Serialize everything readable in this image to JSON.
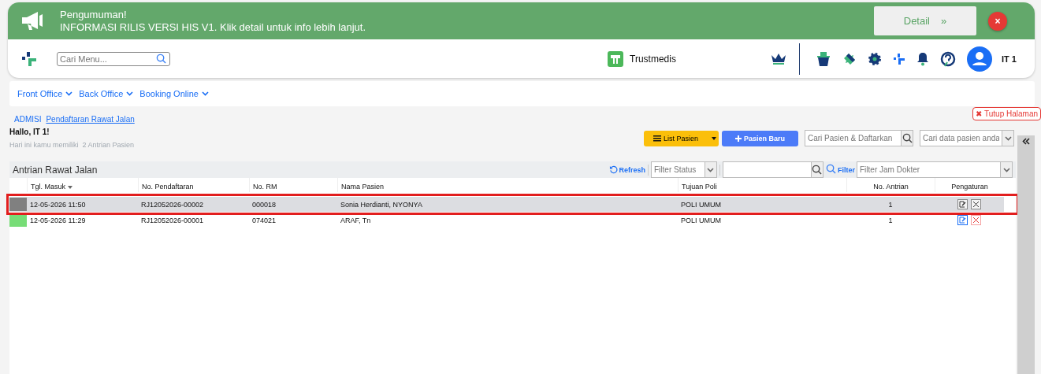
{
  "announcement": {
    "title": "Pengumuman!",
    "message": "INFORMASI RILIS VERSI HIS V1. Klik detail untuk info lebih lanjut.",
    "detail_button": "Detail",
    "detail_arrow": "»",
    "close": "×"
  },
  "header": {
    "search": {
      "placeholder": "Cari Menu..."
    },
    "brand": "Trustmedis",
    "user": "IT 1"
  },
  "nav": [
    {
      "label": "Front Office"
    },
    {
      "label": "Back Office"
    },
    {
      "label": "Booking Online"
    }
  ],
  "breadcrumb": [
    {
      "label": "ADMISI",
      "current": false
    },
    {
      "label": "Pendaftaran Rawat Jalan",
      "current": true
    }
  ],
  "close_page": "Tutup Halaman",
  "close_page_icon": "✖",
  "greeting": "Hallo, IT 1!",
  "summary": "Hari ini kamu memiliki  2 Antrian Pasien",
  "actions": {
    "list_button": "List Pasien",
    "new_button": "Pasien Baru",
    "search_register": {
      "placeholder": "Cari Pasien & Daftarkan"
    },
    "search_patient": {
      "placeholder": "Cari data pasien anda"
    }
  },
  "panel": {
    "title": "Antrian Rawat Jalan",
    "refresh": "Refresh",
    "filter_status": {
      "placeholder": "Filter Status"
    },
    "filter_label": "Filter",
    "filter_doctor": {
      "placeholder": "Filter Jam Dokter"
    }
  },
  "table": {
    "columns": [
      "Tgl. Masuk",
      "No. Pendaftaran",
      "No. RM",
      "Nama Pasien",
      "Tujuan Poli",
      "No. Antrian",
      "Pengaturan"
    ],
    "rows": [
      {
        "selected": true,
        "color": "#808080",
        "cells": [
          "12-05-2026 11:50",
          "RJ12052026-00002",
          "000018",
          "Sonia Herdianti, NYONYA",
          "POLI UMUM",
          "1"
        ]
      },
      {
        "selected": false,
        "color": "#77dd77",
        "cells": [
          "12-05-2026 11:29",
          "RJ12052026-00001",
          "074021",
          "ARAF, Tn",
          "POLI UMUM",
          "1"
        ]
      }
    ]
  }
}
